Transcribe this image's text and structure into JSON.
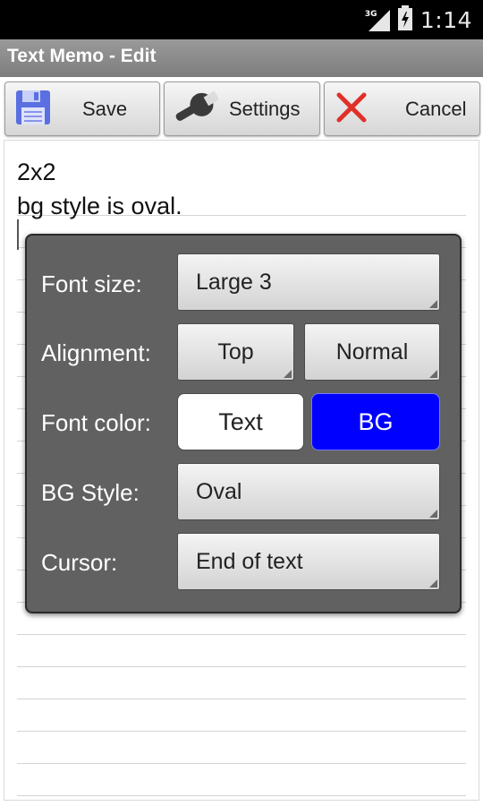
{
  "status_bar": {
    "network": "3G",
    "time": "1:14"
  },
  "title": "Text Memo - Edit",
  "toolbar": {
    "save_label": "Save",
    "settings_label": "Settings",
    "cancel_label": "Cancel"
  },
  "memo": {
    "lines": [
      "2x2",
      "bg style is oval."
    ]
  },
  "settings_dialog": {
    "font_size": {
      "label": "Font size:",
      "value": "Large 3"
    },
    "alignment": {
      "label": "Alignment:",
      "vertical": "Top",
      "horizontal": "Normal"
    },
    "font_color": {
      "label": "Font color:",
      "text_button": "Text",
      "bg_button": "BG"
    },
    "bg_style": {
      "label": "BG Style:",
      "value": "Oval"
    },
    "cursor": {
      "label": "Cursor:",
      "value": "End of text"
    }
  },
  "colors": {
    "bg_button": "#0000ff",
    "title_bar": "#8a8a8a",
    "dialog_bg": "#616161",
    "cancel_icon": "#e0302a",
    "save_icon": "#5a6fe0"
  }
}
